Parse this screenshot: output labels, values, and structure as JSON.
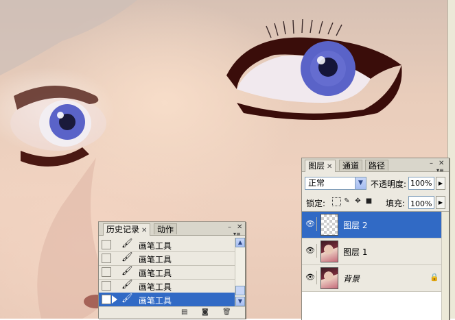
{
  "layers_panel": {
    "tabs": [
      {
        "label": "图层",
        "active": true
      },
      {
        "label": "通道",
        "active": false
      },
      {
        "label": "路径",
        "active": false
      }
    ],
    "blend_mode": "正常",
    "opacity_label": "不透明度:",
    "opacity_value": "100%",
    "lock_label": "锁定:",
    "fill_label": "填充:",
    "fill_value": "100%",
    "layers": [
      {
        "name": "图层 2",
        "selected": true,
        "thumbnail": "transparent",
        "visible": true,
        "locked": false
      },
      {
        "name": "图层 1",
        "selected": false,
        "thumbnail": "photo",
        "visible": true,
        "locked": false
      },
      {
        "name": "背景",
        "selected": false,
        "thumbnail": "photo",
        "visible": true,
        "locked": true
      }
    ]
  },
  "history_panel": {
    "tabs": [
      {
        "label": "历史记录",
        "active": true
      },
      {
        "label": "动作",
        "active": false
      }
    ],
    "items": [
      {
        "label": "画笔工具",
        "icon": "brush-icon",
        "selected": false
      },
      {
        "label": "画笔工具",
        "icon": "brush-icon",
        "selected": false
      },
      {
        "label": "画笔工具",
        "icon": "brush-icon",
        "selected": false
      },
      {
        "label": "画笔工具",
        "icon": "brush-icon",
        "selected": false
      },
      {
        "label": "画笔工具",
        "icon": "brush-icon",
        "selected": true
      }
    ]
  },
  "colors": {
    "selection": "#316ac5",
    "panel_bg": "#ece9e0",
    "eyeliner": "#3a0d0a",
    "iris": "#5a63c8"
  }
}
